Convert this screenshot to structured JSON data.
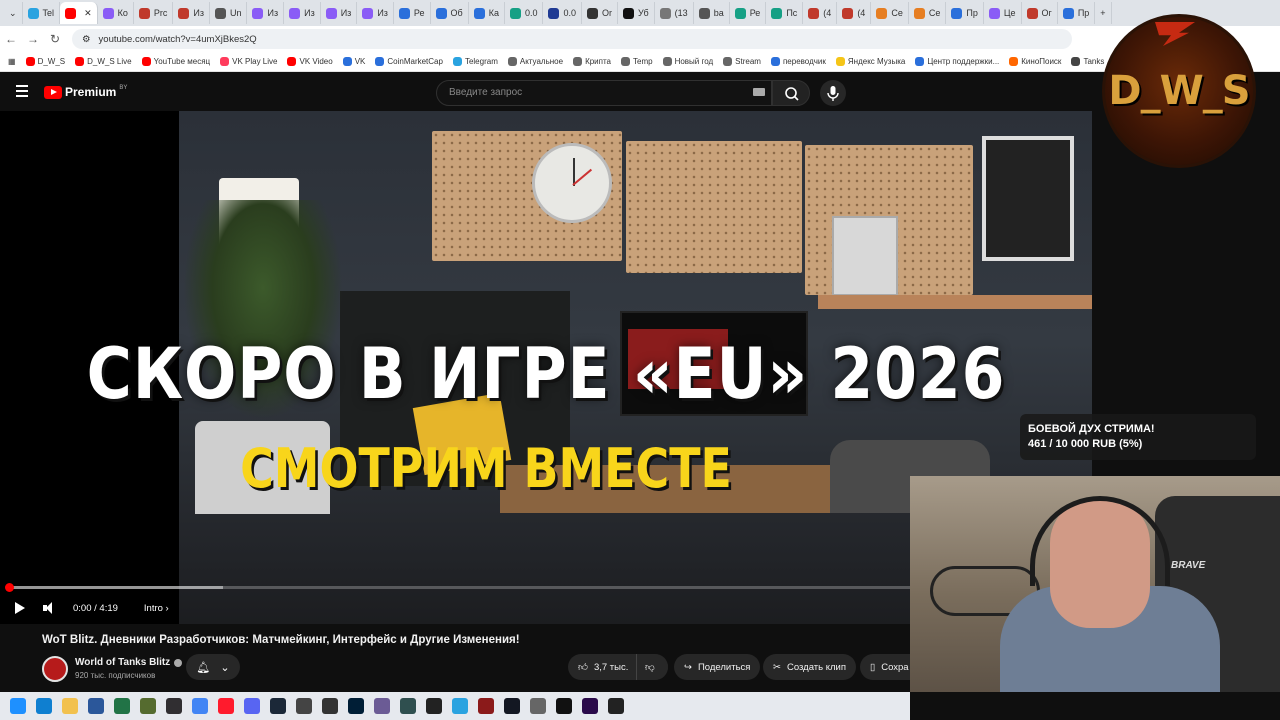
{
  "browser": {
    "tabs": [
      {
        "label": "Tel",
        "color": "#2aa3e0"
      },
      {
        "label": "",
        "color": "#ff0000",
        "active": true
      },
      {
        "label": "Ко",
        "color": "#8a5cf6"
      },
      {
        "label": "Prc",
        "color": "#c0392b"
      },
      {
        "label": "Из",
        "color": "#c0392b"
      },
      {
        "label": "Un",
        "color": "#555555"
      },
      {
        "label": "Из",
        "color": "#8a5cf6"
      },
      {
        "label": "Из",
        "color": "#8a5cf6"
      },
      {
        "label": "Из",
        "color": "#8a5cf6"
      },
      {
        "label": "Из",
        "color": "#8a5cf6"
      },
      {
        "label": "Ре",
        "color": "#2a6fdb"
      },
      {
        "label": "Об",
        "color": "#2a6fdb"
      },
      {
        "label": "Ка",
        "color": "#2a6fdb"
      },
      {
        "label": "0.0",
        "color": "#16a085"
      },
      {
        "label": "0.0",
        "color": "#1f3a93"
      },
      {
        "label": "Or",
        "color": "#333333"
      },
      {
        "label": "Уб",
        "color": "#111111"
      },
      {
        "label": "(13",
        "color": "#777777"
      },
      {
        "label": "ba",
        "color": "#555555"
      },
      {
        "label": "Ре",
        "color": "#16a085"
      },
      {
        "label": "Пс",
        "color": "#16a085"
      },
      {
        "label": "(4",
        "color": "#c0392b"
      },
      {
        "label": "(4",
        "color": "#c0392b"
      },
      {
        "label": "Се",
        "color": "#e67e22"
      },
      {
        "label": "Се",
        "color": "#e67e22"
      },
      {
        "label": "Пр",
        "color": "#2a6fdb"
      },
      {
        "label": "Це",
        "color": "#8a5cf6"
      },
      {
        "label": "Ог",
        "color": "#c0392b"
      },
      {
        "label": "Пр",
        "color": "#2a6fdb"
      }
    ],
    "url": "youtube.com/watch?v=4umXjBkes2Q",
    "bookmarks": [
      {
        "label": "D_W_S",
        "color": "#ff0000"
      },
      {
        "label": "D_W_S Live",
        "color": "#ff0000"
      },
      {
        "label": "YouTube месяц",
        "color": "#ff0000"
      },
      {
        "label": "VK Play Live",
        "color": "#ff3b5c"
      },
      {
        "label": "VK Video",
        "color": "#ff0000"
      },
      {
        "label": "VK",
        "color": "#2a6fdb"
      },
      {
        "label": "CoinMarketCap",
        "color": "#2a6fdb"
      },
      {
        "label": "Telegram",
        "color": "#2aa3e0"
      },
      {
        "label": "Актуальное",
        "color": "#666666"
      },
      {
        "label": "Крипта",
        "color": "#666666"
      },
      {
        "label": "Temp",
        "color": "#666666"
      },
      {
        "label": "Новый год",
        "color": "#666666"
      },
      {
        "label": "Stream",
        "color": "#666666"
      },
      {
        "label": "переводчик",
        "color": "#2a6fdb"
      },
      {
        "label": "Яндекс Музыка",
        "color": "#f5c518"
      },
      {
        "label": "Центр поддержки...",
        "color": "#2a6fdb"
      },
      {
        "label": "КиноПоиск",
        "color": "#ff6600"
      },
      {
        "label": "Tanks",
        "color": "#444444"
      }
    ]
  },
  "youtube": {
    "logo": "Premium",
    "logo_region": "BY",
    "search_placeholder": "Введите запрос"
  },
  "video": {
    "thumbnail_title_line1": "СКОРО В ИГРЕ «EU» 2026",
    "thumbnail_title_line2": "СМОТРИМ ВМЕСТЕ",
    "time": "0:00 / 4:19",
    "chapter": "Intro",
    "progress": 0.0,
    "buffered": 0.2
  },
  "info": {
    "title": "WoT Blitz. Дневники Разработчиков: Матчмейкинг, Интерфейс и Другие Изменения!",
    "channel": "World of Tanks Blitz",
    "subscribers": "920 тыс. подписчиков",
    "likes": "3,7 тыс.",
    "share_label": "Поделиться",
    "clip_label": "Создать клип",
    "save_label": "Сохра"
  },
  "overlay": {
    "logo_text": "D_W_S",
    "donation_title": "БОЕВОЙ ДУХ СТРИМА!",
    "donation_amount": "461 / 10 000 RUB (5%)",
    "chair_brand": "BRAVE"
  },
  "taskbar": {
    "icons": [
      {
        "name": "windows-start-icon",
        "color": "#1e90ff"
      },
      {
        "name": "edge-icon",
        "color": "#0f7fd0"
      },
      {
        "name": "explorer-icon",
        "color": "#f2c14e"
      },
      {
        "name": "word-icon",
        "color": "#2b579a"
      },
      {
        "name": "excel-icon",
        "color": "#217346"
      },
      {
        "name": "game-icon",
        "color": "#556b2f"
      },
      {
        "name": "obs-icon",
        "color": "#302e31"
      },
      {
        "name": "chrome-icon",
        "color": "#4285f4"
      },
      {
        "name": "opera-icon",
        "color": "#ff1b2d"
      },
      {
        "name": "discord-icon",
        "color": "#5865f2"
      },
      {
        "name": "steam-icon",
        "color": "#1b2838"
      },
      {
        "name": "app-icon",
        "color": "#444444"
      },
      {
        "name": "app2-icon",
        "color": "#333333"
      },
      {
        "name": "photoshop-icon",
        "color": "#001e36"
      },
      {
        "name": "image-icon",
        "color": "#6b5b95"
      },
      {
        "name": "app3-icon",
        "color": "#2f4f4f"
      },
      {
        "name": "terminal-icon",
        "color": "#222222"
      },
      {
        "name": "telegram-icon",
        "color": "#2aa3e0"
      },
      {
        "name": "wot-icon",
        "color": "#8b1a1a"
      },
      {
        "name": "tradingview-icon",
        "color": "#131722"
      },
      {
        "name": "app4-icon",
        "color": "#666666"
      },
      {
        "name": "app5-icon",
        "color": "#111111"
      },
      {
        "name": "premiere-icon",
        "color": "#2a0a4a"
      },
      {
        "name": "app6-icon",
        "color": "#222222"
      }
    ]
  }
}
